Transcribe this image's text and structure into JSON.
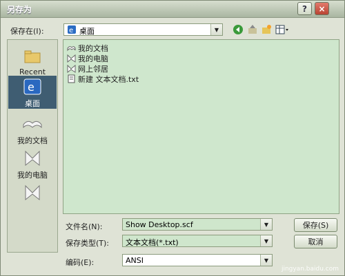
{
  "window": {
    "title": "另存为",
    "help": "?",
    "close": "×"
  },
  "save_in": {
    "label": "保存在(I):",
    "value": "桌面"
  },
  "places": [
    {
      "label": "Recent"
    },
    {
      "label": "桌面"
    },
    {
      "label": "我的文档"
    },
    {
      "label": "我的电脑"
    },
    {
      "label": ""
    }
  ],
  "files": [
    {
      "name": "我的文档"
    },
    {
      "name": "我的电脑"
    },
    {
      "name": "网上邻居"
    },
    {
      "name": "新建 文本文档.txt"
    }
  ],
  "filename": {
    "label": "文件名(N):",
    "value": "Show Desktop.scf"
  },
  "filetype": {
    "label": "保存类型(T):",
    "value": "文本文档(*.txt)"
  },
  "encoding": {
    "label": "编码(E):",
    "value": "ANSI"
  },
  "buttons": {
    "save": "保存(S)",
    "cancel": "取消"
  },
  "watermark": "jingyan.baidu.com"
}
